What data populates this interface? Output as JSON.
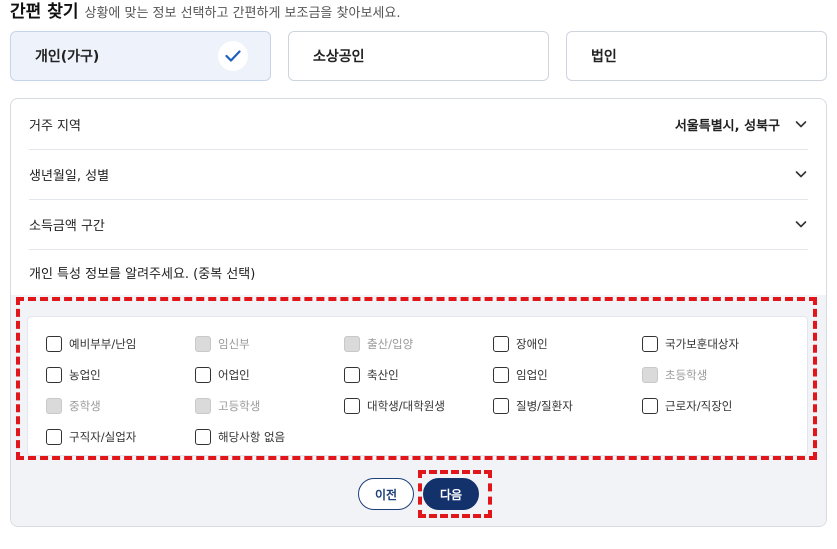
{
  "header": {
    "title": "간편 찾기",
    "subtitle": "상황에 맞는 정보 선택하고 간편하게 보조금을 찾아보세요."
  },
  "applicant_types": [
    {
      "label": "개인(가구)",
      "selected": true
    },
    {
      "label": "소상공인",
      "selected": false
    },
    {
      "label": "법인",
      "selected": false
    }
  ],
  "form": {
    "residence": {
      "label": "거주 지역",
      "value": "서울특별시, 성북구"
    },
    "birth_gender": {
      "label": "생년월일, 성별"
    },
    "income": {
      "label": "소득금액 구간"
    },
    "traits_title": "개인 특성 정보를 알려주세요. (중복 선택)"
  },
  "traits": [
    {
      "label": "예비부부/난임",
      "disabled": false
    },
    {
      "label": "임신부",
      "disabled": true
    },
    {
      "label": "출산/입양",
      "disabled": true
    },
    {
      "label": "장애인",
      "disabled": false
    },
    {
      "label": "국가보훈대상자",
      "disabled": false
    },
    {
      "label": "농업인",
      "disabled": false
    },
    {
      "label": "어업인",
      "disabled": false
    },
    {
      "label": "축산인",
      "disabled": false
    },
    {
      "label": "임업인",
      "disabled": false
    },
    {
      "label": "초등학생",
      "disabled": true
    },
    {
      "label": "중학생",
      "disabled": true
    },
    {
      "label": "고등학생",
      "disabled": true
    },
    {
      "label": "대학생/대학원생",
      "disabled": false
    },
    {
      "label": "질병/질환자",
      "disabled": false
    },
    {
      "label": "근로자/직장인",
      "disabled": false
    },
    {
      "label": "구직자/실업자",
      "disabled": false
    },
    {
      "label": "해당사항 없음",
      "disabled": false
    }
  ],
  "buttons": {
    "prev": "이전",
    "next": "다음"
  },
  "colors": {
    "highlight": "#e0161b",
    "primary": "#13316b",
    "check": "#1d5fbf"
  }
}
